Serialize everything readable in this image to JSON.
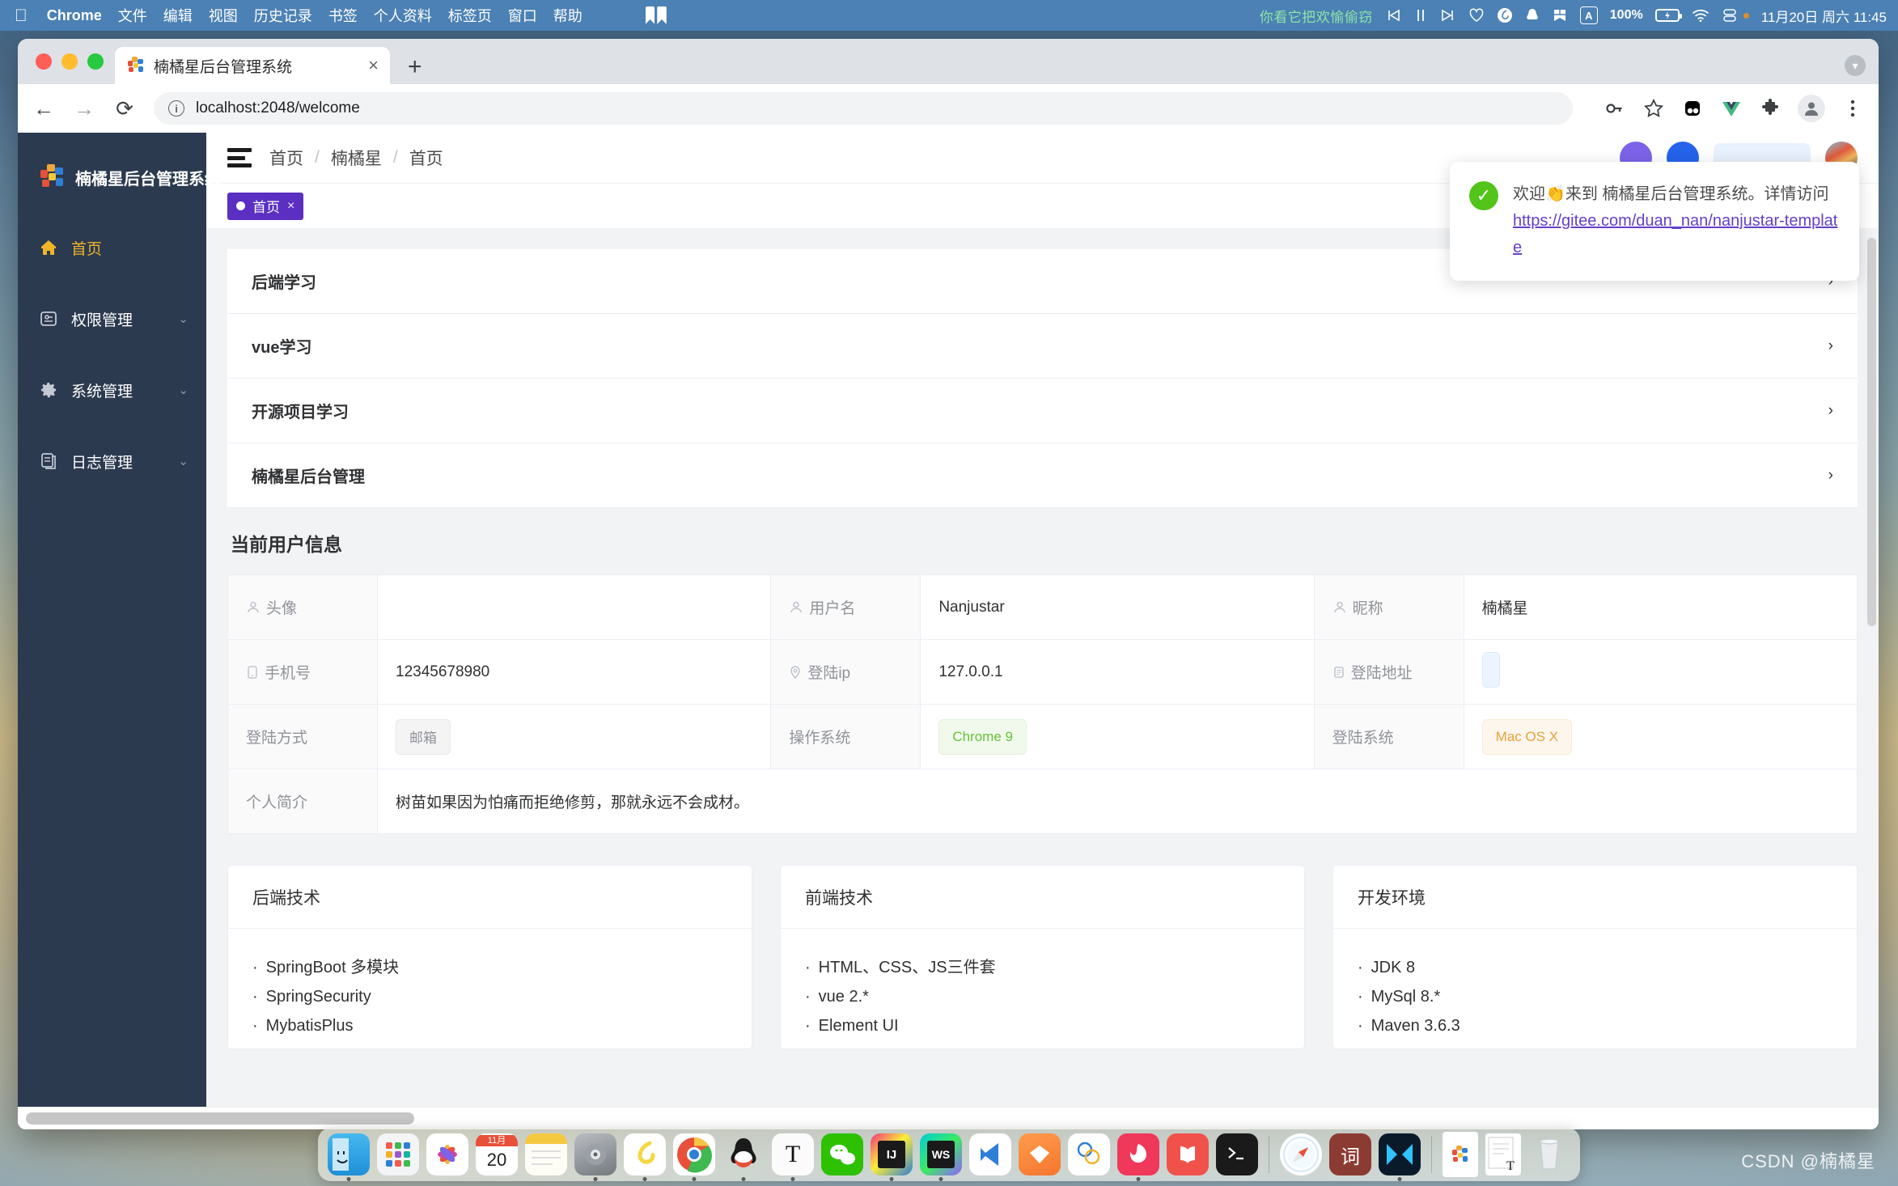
{
  "menubar": {
    "apple_icon": "apple-icon",
    "app_name": "Chrome",
    "items": [
      "文件",
      "编辑",
      "视图",
      "历史记录",
      "书签",
      "个人资料",
      "标签页",
      "窗口",
      "帮助"
    ],
    "music_text": "你看它把欢愉偷窃",
    "media_icons": [
      "previous-track-icon",
      "pause-icon",
      "next-track-icon",
      "heart-icon",
      "netease-music-icon",
      "qq-icon",
      "bookmark-icon"
    ],
    "input_source": "A",
    "battery_percent": "100%",
    "battery_icon": "battery-charging-icon",
    "wifi_icon": "wifi-icon",
    "control_center_icon": "control-center-icon",
    "datetime": "11月20日 周六  11:45"
  },
  "browser": {
    "tab": {
      "title": "楠橘星后台管理系统",
      "favicon": "nanjustar-logo-icon",
      "close": "×"
    },
    "new_tab": "+",
    "back": "←",
    "forward": "→",
    "reload": "⟳",
    "url": "localhost:2048/welcome",
    "toolbar_icons": [
      "key-icon",
      "star-icon",
      "panda-extension-icon",
      "vue-devtools-icon",
      "extensions-puzzle-icon",
      "profile-avatar-icon",
      "chrome-menu-icon"
    ]
  },
  "sidebar": {
    "brand": "楠橘星后台管理系统",
    "items": [
      {
        "label": "首页",
        "icon": "home-icon",
        "active": true,
        "expandable": false
      },
      {
        "label": "权限管理",
        "icon": "permission-icon",
        "active": false,
        "expandable": true
      },
      {
        "label": "系统管理",
        "icon": "gear-icon",
        "active": false,
        "expandable": true
      },
      {
        "label": "日志管理",
        "icon": "log-icon",
        "active": false,
        "expandable": true
      }
    ],
    "arrow": "⌄"
  },
  "header": {
    "menu_toggle": "collapse-menu-icon",
    "breadcrumb": [
      "首页",
      "楠橘星",
      "首页"
    ],
    "separator": "/"
  },
  "tagbar": {
    "tag_label": "首页",
    "tag_close": "×"
  },
  "toast": {
    "icon": "success-check-icon",
    "text": "欢迎👏来到 楠橘星后台管理系统。详情访问",
    "link": "https://gitee.com/duan_nan/nanjustar-template"
  },
  "collapse_rows": [
    {
      "label": "后端学习",
      "arrow": "›"
    },
    {
      "label": "vue学习",
      "arrow": "›"
    },
    {
      "label": "开源项目学习",
      "arrow": "›"
    },
    {
      "label": "楠橘星后台管理",
      "arrow": "›"
    }
  ],
  "user_info": {
    "section_title": "当前用户信息",
    "rows": [
      [
        {
          "type": "label",
          "icon": "user-icon",
          "text": "头像"
        },
        {
          "type": "avatar"
        },
        {
          "type": "label",
          "icon": "user-icon",
          "text": "用户名"
        },
        {
          "type": "value",
          "text": "Nanjustar"
        },
        {
          "type": "label",
          "icon": "user-icon",
          "text": "昵称"
        },
        {
          "type": "value",
          "text": "楠橘星"
        }
      ],
      [
        {
          "type": "label",
          "icon": "phone-icon",
          "text": "手机号"
        },
        {
          "type": "value",
          "text": "12345678980"
        },
        {
          "type": "label",
          "icon": "location-icon",
          "text": "登陆ip"
        },
        {
          "type": "value",
          "text": "127.0.0.1"
        },
        {
          "type": "label",
          "icon": "list-icon",
          "text": "登陆地址"
        },
        {
          "type": "chip-blue-empty",
          "text": ""
        }
      ],
      [
        {
          "type": "label",
          "icon": "",
          "text": "登陆方式"
        },
        {
          "type": "chip-gray",
          "text": "邮箱"
        },
        {
          "type": "label",
          "icon": "",
          "text": "操作系统"
        },
        {
          "type": "chip-green",
          "text": "Chrome 9"
        },
        {
          "type": "label",
          "icon": "",
          "text": "登陆系统"
        },
        {
          "type": "chip-orange",
          "text": "Mac OS X"
        }
      ]
    ],
    "bio_label": "个人简介",
    "bio_value": "树苗如果因为怕痛而拒绝修剪，那就永远不会成材。"
  },
  "tech_cards": [
    {
      "title": "后端技术",
      "items": [
        "SpringBoot 多模块",
        "SpringSecurity",
        "MybatisPlus"
      ]
    },
    {
      "title": "前端技术",
      "items": [
        "HTML、CSS、JS三件套",
        "vue 2.*",
        "Element UI"
      ]
    },
    {
      "title": "开发环境",
      "items": [
        "JDK 8",
        "MySql 8.*",
        "Maven 3.6.3"
      ]
    }
  ],
  "dock": {
    "icons": [
      {
        "name": "finder-icon",
        "running": true
      },
      {
        "name": "launchpad-icon",
        "running": false
      },
      {
        "name": "photos-icon",
        "running": false
      },
      {
        "name": "calendar-icon",
        "running": false,
        "month": "11月",
        "day": "20"
      },
      {
        "name": "notes-icon",
        "running": false
      },
      {
        "name": "system-preferences-icon",
        "running": true
      },
      {
        "name": "netease-music-icon",
        "running": true
      },
      {
        "name": "chrome-icon",
        "running": true
      },
      {
        "name": "qq-icon",
        "running": true
      },
      {
        "name": "typora-icon",
        "running": true
      },
      {
        "name": "wechat-icon",
        "running": false
      },
      {
        "name": "intellij-idea-icon",
        "running": true
      },
      {
        "name": "webstorm-icon",
        "running": true
      },
      {
        "name": "vscode-icon",
        "running": false
      },
      {
        "name": "sketch-icon",
        "running": false
      },
      {
        "name": "figma-icon",
        "running": false
      },
      {
        "name": "firefox-dev-icon",
        "running": true
      },
      {
        "name": "books-icon",
        "running": false
      },
      {
        "name": "terminal-icon",
        "running": false
      },
      {
        "name": "safari-icon",
        "running": false
      },
      {
        "name": "dictionary-icon",
        "running": false
      },
      {
        "name": "bilibili-icon",
        "running": true
      },
      {
        "name": "document-folder-icon",
        "running": false
      },
      {
        "name": "document-stack-icon",
        "running": false
      },
      {
        "name": "trash-icon",
        "running": false
      }
    ]
  },
  "watermark": "CSDN @楠橘星"
}
